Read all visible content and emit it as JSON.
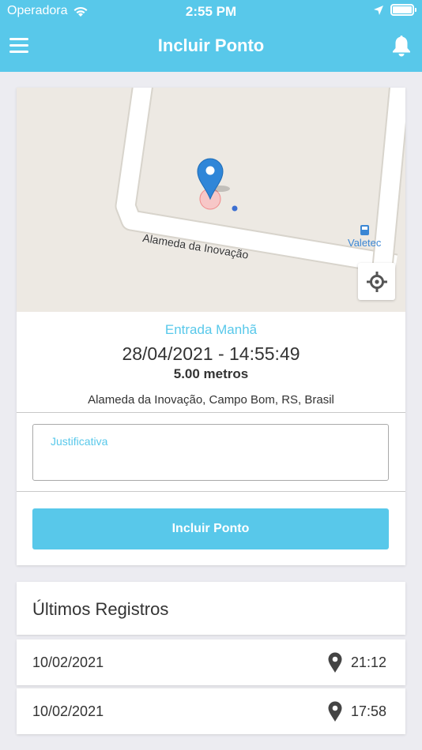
{
  "status_bar": {
    "carrier": "Operadora",
    "time": "2:55 PM"
  },
  "nav": {
    "title": "Incluir Ponto",
    "menu_icon": "hamburger-menu-icon",
    "bell_icon": "bell-icon"
  },
  "map": {
    "street_label": "Alameda da Inovação",
    "poi_label": "Valetec"
  },
  "punch": {
    "type": "Entrada Manhã",
    "datetime": "28/04/2021 - 14:55:49",
    "distance": "5.00 metros",
    "address": "Alameda da Inovação, Campo Bom, RS, Brasil"
  },
  "justification": {
    "label": "Justificativa",
    "value": ""
  },
  "submit_label": "Incluir Ponto",
  "records": {
    "title": "Últimos Registros",
    "items": [
      {
        "date": "10/02/2021",
        "time": "21:12"
      },
      {
        "date": "10/02/2021",
        "time": "17:58"
      }
    ]
  },
  "colors": {
    "accent": "#58c8ea",
    "background": "#ececf1"
  }
}
